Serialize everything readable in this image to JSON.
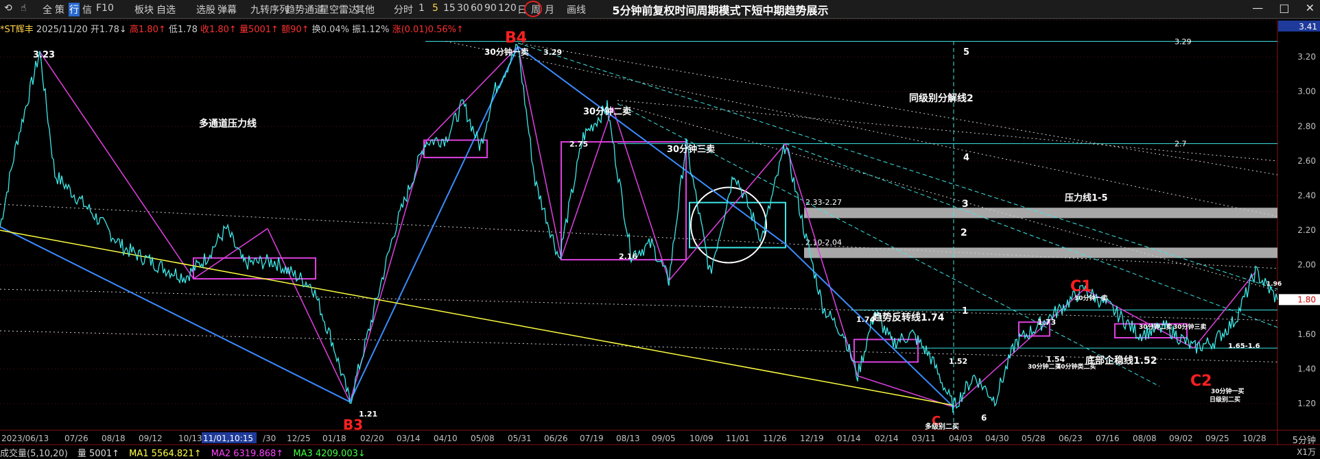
{
  "toolbar": {
    "items": [
      "全",
      "策",
      "行",
      "信",
      "F10",
      "板块",
      "自选",
      "选股",
      "弹幕",
      "九转序列",
      "趋势通道",
      "星空雷达",
      "其他",
      "分时",
      "1",
      "5",
      "15",
      "30",
      "60",
      "90",
      "120",
      "日",
      "周",
      "月",
      "画线"
    ],
    "selected": "5",
    "title": "5分钟前复权时间周期模式下短中期趋势展示"
  },
  "info": {
    "name": "*ST辉丰",
    "date": "2025/11/20",
    "open": "开1.78↓",
    "high": "高1.80↑",
    "low": "低1.78",
    "close": "收1.80↑",
    "vol": "量5001↑",
    "amount": "额90↑",
    "turnover": "换0.04%",
    "amplitude": "振1.12%",
    "change": "涨(0.01)0.56%↑"
  },
  "volume": {
    "label": "成交量(5,10,20)",
    "vol": "量 5001↑",
    "ma1": "MA1 5564.821↑",
    "ma2": "MA2 6319.868↑",
    "ma3": "MA3 4209.003↓"
  },
  "period_label": "5分钟",
  "x1_label": "X1万",
  "colors": {
    "price": "#3ee8e8",
    "up": "#ff3030",
    "magenta": "#e040e0",
    "blue": "#3a8cff",
    "yellow": "#ffff40",
    "gray": "#b0b0b0"
  },
  "chart_data": {
    "type": "line",
    "title": "5分钟前复权时间周期模式下短中期趋势展示",
    "y_range": [
      1.15,
      3.41
    ],
    "y_ticks": [
      "3.41",
      "3.20",
      "3.00",
      "2.80",
      "2.60",
      "2.40",
      "2.20",
      "2.00",
      "1.80",
      "1.60",
      "1.40",
      "1.20"
    ],
    "current_price": "1.80",
    "x_ticks": [
      "2023/06/13",
      "07/26",
      "08/18",
      "09/12",
      "10/13",
      "11/01,10:15",
      "/30",
      "12/25",
      "01/18",
      "02/20",
      "03/14",
      "04/10",
      "05/08",
      "05/31",
      "06/26",
      "07/19",
      "08/13",
      "09/05",
      "10/09",
      "11/01",
      "11/26",
      "12/19",
      "01/14",
      "02/14",
      "03/11",
      "04/03",
      "04/30",
      "05/28",
      "06/23",
      "07/16",
      "08/08",
      "09/02",
      "09/25",
      "10/28"
    ],
    "pivots": [
      {
        "i": 0,
        "p": 2.22
      },
      {
        "i": 24,
        "p": 2.7
      },
      {
        "i": 58,
        "p": 3.23
      },
      {
        "i": 80,
        "p": 2.52
      },
      {
        "i": 130,
        "p": 2.32
      },
      {
        "i": 180,
        "p": 2.1
      },
      {
        "i": 240,
        "p": 1.98
      },
      {
        "i": 270,
        "p": 1.93
      },
      {
        "i": 300,
        "p": 2.04
      },
      {
        "i": 330,
        "p": 2.21
      },
      {
        "i": 355,
        "p": 2.01
      },
      {
        "i": 400,
        "p": 2.02
      },
      {
        "i": 430,
        "p": 1.94
      },
      {
        "i": 455,
        "p": 1.88
      },
      {
        "i": 485,
        "p": 1.55
      },
      {
        "i": 510,
        "p": 1.21
      },
      {
        "i": 535,
        "p": 1.58
      },
      {
        "i": 575,
        "p": 2.2
      },
      {
        "i": 620,
        "p": 2.71
      },
      {
        "i": 650,
        "p": 2.73
      },
      {
        "i": 675,
        "p": 2.93
      },
      {
        "i": 700,
        "p": 2.68
      },
      {
        "i": 720,
        "p": 3.0
      },
      {
        "i": 755,
        "p": 3.26
      },
      {
        "i": 780,
        "p": 2.48
      },
      {
        "i": 815,
        "p": 2.04
      },
      {
        "i": 850,
        "p": 2.74
      },
      {
        "i": 885,
        "p": 2.91
      },
      {
        "i": 920,
        "p": 2.06
      },
      {
        "i": 950,
        "p": 2.12
      },
      {
        "i": 975,
        "p": 1.91
      },
      {
        "i": 1000,
        "p": 2.7
      },
      {
        "i": 1035,
        "p": 1.95
      },
      {
        "i": 1070,
        "p": 2.54
      },
      {
        "i": 1110,
        "p": 2.15
      },
      {
        "i": 1145,
        "p": 2.7
      },
      {
        "i": 1175,
        "p": 2.15
      },
      {
        "i": 1200,
        "p": 1.75
      },
      {
        "i": 1230,
        "p": 1.6
      },
      {
        "i": 1250,
        "p": 1.36
      },
      {
        "i": 1275,
        "p": 1.73
      },
      {
        "i": 1300,
        "p": 1.55
      },
      {
        "i": 1330,
        "p": 1.6
      },
      {
        "i": 1355,
        "p": 1.48
      },
      {
        "i": 1390,
        "p": 1.18
      },
      {
        "i": 1420,
        "p": 1.36
      },
      {
        "i": 1450,
        "p": 1.22
      },
      {
        "i": 1480,
        "p": 1.55
      },
      {
        "i": 1510,
        "p": 1.64
      },
      {
        "i": 1540,
        "p": 1.73
      },
      {
        "i": 1580,
        "p": 1.86
      },
      {
        "i": 1620,
        "p": 1.75
      },
      {
        "i": 1660,
        "p": 1.6
      },
      {
        "i": 1700,
        "p": 1.64
      },
      {
        "i": 1740,
        "p": 1.52
      },
      {
        "i": 1770,
        "p": 1.56
      },
      {
        "i": 1800,
        "p": 1.68
      },
      {
        "i": 1830,
        "p": 1.96
      },
      {
        "i": 1862,
        "p": 1.8
      }
    ],
    "h_lines": [
      {
        "p": 3.29,
        "label": "3.29"
      },
      {
        "p": 2.7,
        "label": "2.7"
      },
      {
        "p": 1.74,
        "label": ""
      },
      {
        "p": 1.52,
        "label": ""
      }
    ],
    "gray_zones": [
      {
        "from": 2.27,
        "to": 2.33,
        "label": "2.33-2.27"
      },
      {
        "from": 2.04,
        "to": 2.1,
        "label": "2.10-2.04"
      }
    ],
    "annotations": [
      {
        "text": "B4",
        "color": "red",
        "big": true
      },
      {
        "text": "B3",
        "color": "red",
        "big": true
      },
      {
        "text": "C1",
        "color": "red",
        "big": true
      },
      {
        "text": "C2",
        "color": "red",
        "big": true
      },
      {
        "text": "C",
        "color": "red",
        "big": true
      },
      {
        "text": "3.23"
      },
      {
        "text": "多通道压力线"
      },
      {
        "text": "30分钟一卖"
      },
      {
        "text": "3.29"
      },
      {
        "text": "30分钟二卖"
      },
      {
        "text": "30分钟三卖"
      },
      {
        "text": "同级别分解线2"
      },
      {
        "text": "压力线1-5"
      },
      {
        "text": "趋势反转线1.74"
      },
      {
        "text": "底部企稳线1.52"
      },
      {
        "text": "2.75"
      },
      {
        "text": "2.16"
      },
      {
        "text": "1.74"
      },
      {
        "text": "1.52"
      },
      {
        "text": "1.21"
      },
      {
        "text": "5"
      },
      {
        "text": "4"
      },
      {
        "text": "3"
      },
      {
        "text": "2"
      },
      {
        "text": "1"
      },
      {
        "text": "1.73"
      },
      {
        "text": "1.54"
      },
      {
        "text": "30分钟一卖"
      },
      {
        "text": "30分钟二卖"
      },
      {
        "text": "30分钟三卖"
      },
      {
        "text": "30分钟二买"
      },
      {
        "text": "30分钟类二买"
      },
      {
        "text": "多级别二买"
      },
      {
        "text": "1.96"
      },
      {
        "text": "1.65-1.6"
      },
      {
        "text": "30分钟一买"
      },
      {
        "text": "日级别二买"
      },
      {
        "text": "6"
      }
    ]
  }
}
